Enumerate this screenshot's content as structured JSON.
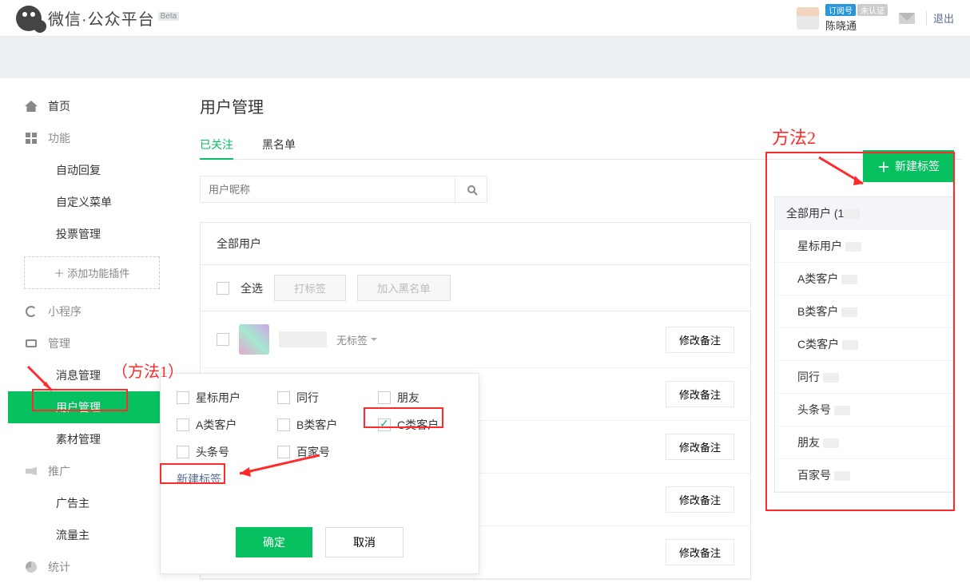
{
  "header": {
    "logo_text": "微信·公众平台",
    "beta": "Beta",
    "badge_type": "订阅号",
    "badge_cert": "未认证",
    "username": "陈晓通",
    "logout": "退出"
  },
  "sidebar": {
    "home": "首页",
    "features": "功能",
    "feature_items": [
      "自动回复",
      "自定义菜单",
      "投票管理"
    ],
    "add_plugin": "添加功能插件",
    "miniprogram": "小程序",
    "manage": "管理",
    "manage_items": [
      "消息管理",
      "用户管理",
      "素材管理"
    ],
    "active_manage_index": 1,
    "promote": "推广",
    "promote_items": [
      "广告主",
      "流量主"
    ],
    "stats": "统计"
  },
  "page": {
    "title": "用户管理",
    "tabs": [
      "已关注",
      "黑名单"
    ],
    "active_tab": 0,
    "search_placeholder": "用户昵称",
    "all_users": "全部用户",
    "select_all": "全选",
    "btn_tag": "打标签",
    "btn_blacklist": "加入黑名单",
    "no_tag_label": "无标签",
    "edit_note": "修改备注",
    "user_rows": 5
  },
  "tag_dropdown": {
    "options": [
      {
        "label": "星标用户",
        "checked": false
      },
      {
        "label": "同行",
        "checked": false
      },
      {
        "label": "朋友",
        "checked": false
      },
      {
        "label": "A类客户",
        "checked": false
      },
      {
        "label": "B类客户",
        "checked": false
      },
      {
        "label": "C类客户",
        "checked": true
      },
      {
        "label": "头条号",
        "checked": false
      },
      {
        "label": "百家号",
        "checked": false
      }
    ],
    "new_tag": "新建标签",
    "confirm": "确定",
    "cancel": "取消"
  },
  "right_panel": {
    "new_tag_btn": "新建标签",
    "all_label": "全部用户 (1",
    "tags": [
      "星标用户",
      "A类客户",
      "B类客户",
      "C类客户",
      "同行",
      "头条号",
      "朋友",
      "百家号"
    ]
  },
  "annotations": {
    "method1": "（方法1）",
    "method2": "方法2"
  }
}
